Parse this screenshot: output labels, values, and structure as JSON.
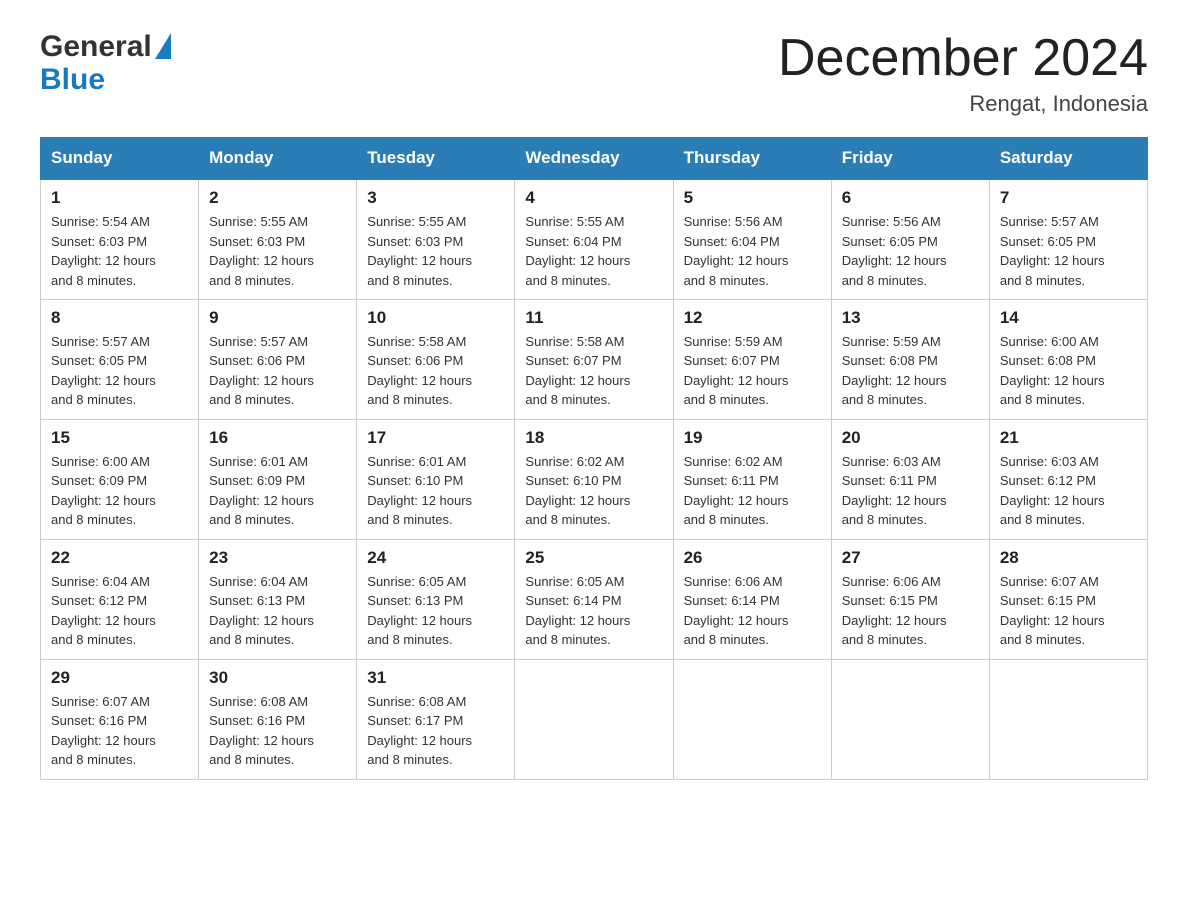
{
  "header": {
    "logo": {
      "general": "General",
      "blue": "Blue"
    },
    "title": "December 2024",
    "subtitle": "Rengat, Indonesia"
  },
  "days_of_week": [
    "Sunday",
    "Monday",
    "Tuesday",
    "Wednesday",
    "Thursday",
    "Friday",
    "Saturday"
  ],
  "weeks": [
    [
      {
        "day": "1",
        "sunrise": "5:54 AM",
        "sunset": "6:03 PM",
        "daylight": "12 hours and 8 minutes."
      },
      {
        "day": "2",
        "sunrise": "5:55 AM",
        "sunset": "6:03 PM",
        "daylight": "12 hours and 8 minutes."
      },
      {
        "day": "3",
        "sunrise": "5:55 AM",
        "sunset": "6:03 PM",
        "daylight": "12 hours and 8 minutes."
      },
      {
        "day": "4",
        "sunrise": "5:55 AM",
        "sunset": "6:04 PM",
        "daylight": "12 hours and 8 minutes."
      },
      {
        "day": "5",
        "sunrise": "5:56 AM",
        "sunset": "6:04 PM",
        "daylight": "12 hours and 8 minutes."
      },
      {
        "day": "6",
        "sunrise": "5:56 AM",
        "sunset": "6:05 PM",
        "daylight": "12 hours and 8 minutes."
      },
      {
        "day": "7",
        "sunrise": "5:57 AM",
        "sunset": "6:05 PM",
        "daylight": "12 hours and 8 minutes."
      }
    ],
    [
      {
        "day": "8",
        "sunrise": "5:57 AM",
        "sunset": "6:05 PM",
        "daylight": "12 hours and 8 minutes."
      },
      {
        "day": "9",
        "sunrise": "5:57 AM",
        "sunset": "6:06 PM",
        "daylight": "12 hours and 8 minutes."
      },
      {
        "day": "10",
        "sunrise": "5:58 AM",
        "sunset": "6:06 PM",
        "daylight": "12 hours and 8 minutes."
      },
      {
        "day": "11",
        "sunrise": "5:58 AM",
        "sunset": "6:07 PM",
        "daylight": "12 hours and 8 minutes."
      },
      {
        "day": "12",
        "sunrise": "5:59 AM",
        "sunset": "6:07 PM",
        "daylight": "12 hours and 8 minutes."
      },
      {
        "day": "13",
        "sunrise": "5:59 AM",
        "sunset": "6:08 PM",
        "daylight": "12 hours and 8 minutes."
      },
      {
        "day": "14",
        "sunrise": "6:00 AM",
        "sunset": "6:08 PM",
        "daylight": "12 hours and 8 minutes."
      }
    ],
    [
      {
        "day": "15",
        "sunrise": "6:00 AM",
        "sunset": "6:09 PM",
        "daylight": "12 hours and 8 minutes."
      },
      {
        "day": "16",
        "sunrise": "6:01 AM",
        "sunset": "6:09 PM",
        "daylight": "12 hours and 8 minutes."
      },
      {
        "day": "17",
        "sunrise": "6:01 AM",
        "sunset": "6:10 PM",
        "daylight": "12 hours and 8 minutes."
      },
      {
        "day": "18",
        "sunrise": "6:02 AM",
        "sunset": "6:10 PM",
        "daylight": "12 hours and 8 minutes."
      },
      {
        "day": "19",
        "sunrise": "6:02 AM",
        "sunset": "6:11 PM",
        "daylight": "12 hours and 8 minutes."
      },
      {
        "day": "20",
        "sunrise": "6:03 AM",
        "sunset": "6:11 PM",
        "daylight": "12 hours and 8 minutes."
      },
      {
        "day": "21",
        "sunrise": "6:03 AM",
        "sunset": "6:12 PM",
        "daylight": "12 hours and 8 minutes."
      }
    ],
    [
      {
        "day": "22",
        "sunrise": "6:04 AM",
        "sunset": "6:12 PM",
        "daylight": "12 hours and 8 minutes."
      },
      {
        "day": "23",
        "sunrise": "6:04 AM",
        "sunset": "6:13 PM",
        "daylight": "12 hours and 8 minutes."
      },
      {
        "day": "24",
        "sunrise": "6:05 AM",
        "sunset": "6:13 PM",
        "daylight": "12 hours and 8 minutes."
      },
      {
        "day": "25",
        "sunrise": "6:05 AM",
        "sunset": "6:14 PM",
        "daylight": "12 hours and 8 minutes."
      },
      {
        "day": "26",
        "sunrise": "6:06 AM",
        "sunset": "6:14 PM",
        "daylight": "12 hours and 8 minutes."
      },
      {
        "day": "27",
        "sunrise": "6:06 AM",
        "sunset": "6:15 PM",
        "daylight": "12 hours and 8 minutes."
      },
      {
        "day": "28",
        "sunrise": "6:07 AM",
        "sunset": "6:15 PM",
        "daylight": "12 hours and 8 minutes."
      }
    ],
    [
      {
        "day": "29",
        "sunrise": "6:07 AM",
        "sunset": "6:16 PM",
        "daylight": "12 hours and 8 minutes."
      },
      {
        "day": "30",
        "sunrise": "6:08 AM",
        "sunset": "6:16 PM",
        "daylight": "12 hours and 8 minutes."
      },
      {
        "day": "31",
        "sunrise": "6:08 AM",
        "sunset": "6:17 PM",
        "daylight": "12 hours and 8 minutes."
      },
      null,
      null,
      null,
      null
    ]
  ],
  "labels": {
    "sunrise": "Sunrise:",
    "sunset": "Sunset:",
    "daylight": "Daylight:"
  }
}
